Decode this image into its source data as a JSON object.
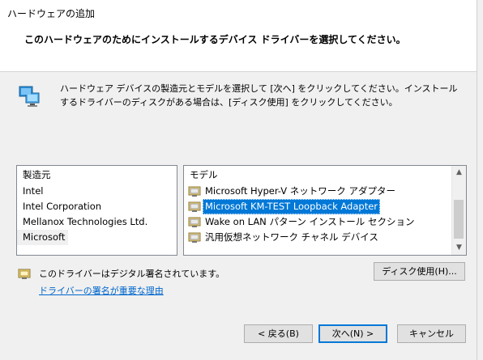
{
  "window": {
    "title": "ハードウェアの追加"
  },
  "header": {
    "heading": "このハードウェアのためにインストールするデバイス ドライバーを選択してください。"
  },
  "intro": {
    "text": "ハードウェア デバイスの製造元とモデルを選択して [次へ] をクリックしてください。インストールするドライバーのディスクがある場合は、[ディスク使用] をクリックしてください。"
  },
  "manufacturers": {
    "header": "製造元",
    "items": [
      "Intel",
      "Intel Corporation",
      "Mellanox Technologies Ltd.",
      "Microsoft"
    ],
    "selected": "Microsoft"
  },
  "models": {
    "header": "モデル",
    "items": [
      "Microsoft Hyper-V ネットワーク アダプター",
      "Microsoft KM-TEST Loopback Adapter",
      "Wake on LAN パターン インストール セクション",
      "汎用仮想ネットワーク チャネル デバイス"
    ],
    "selected": "Microsoft KM-TEST Loopback Adapter"
  },
  "signature": {
    "text": "このドライバーはデジタル署名されています。",
    "link": "ドライバーの署名が重要な理由"
  },
  "buttons": {
    "disk": "ディスク使用(H)...",
    "back": "< 戻る(B)",
    "next": "次へ(N) >",
    "cancel": "キャンセル"
  },
  "icons": {
    "intro": "network-adapter-icon",
    "driver": "driver-icon",
    "signature": "signed-driver-icon",
    "scroll_up": "scroll-up-icon",
    "scroll_down": "scroll-down-icon"
  },
  "colors": {
    "selection": "#0078d7",
    "link": "#0066cc",
    "default_button_border": "#0078d7"
  }
}
